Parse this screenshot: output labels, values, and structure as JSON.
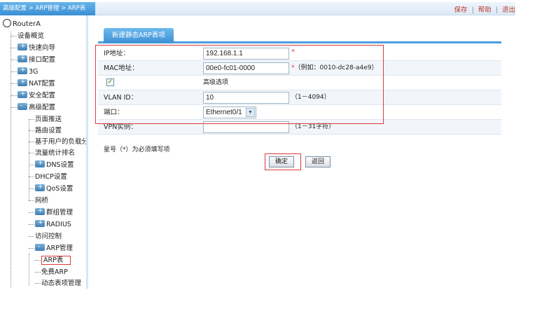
{
  "header": {
    "breadcrumb": "高级配置 > ARP管理 > ARP表",
    "save": "保存",
    "help": "帮助",
    "logout": "退出",
    "separator": "|"
  },
  "sidebar": {
    "root": "RouterA",
    "items": [
      {
        "label": "设备概览"
      },
      {
        "label": "快速向导"
      },
      {
        "label": "接口配置"
      },
      {
        "label": "3G"
      },
      {
        "label": "NAT配置"
      },
      {
        "label": "安全配置"
      },
      {
        "label": "高级配置"
      },
      {
        "label": "页面推送"
      },
      {
        "label": "路由设置"
      },
      {
        "label": "基于用户的负载分"
      },
      {
        "label": "流量统计排名"
      },
      {
        "label": "DNS设置"
      },
      {
        "label": "DHCP设置"
      },
      {
        "label": "QoS设置"
      },
      {
        "label": "网桥"
      },
      {
        "label": "群组管理"
      },
      {
        "label": "RADIUS"
      },
      {
        "label": "访问控制"
      },
      {
        "label": "ARP管理"
      },
      {
        "label": "ARP表"
      },
      {
        "label": "免费ARP"
      },
      {
        "label": "动态表项管理"
      }
    ]
  },
  "main": {
    "tab": "新建静态ARP表项",
    "form": {
      "ip_label": "IP地址：",
      "ip_value": "192.168.1.1",
      "mac_label": "MAC地址：",
      "mac_value": "00e0-fc01-0000",
      "mac_hint": "（例如：0010-dc28-a4e9）",
      "required_mark": "*",
      "checkbox_mark": "✓",
      "advanced_label": "高级选项",
      "vlan_label": "VLAN ID：",
      "vlan_value": "10",
      "vlan_hint": "（1－4094）",
      "port_label": "端口：",
      "port_value": "Ethernet0/1",
      "port_arrow": "▼",
      "vpn_label": "VPN实例：",
      "vpn_value": "",
      "vpn_hint": "（1－31字符）"
    },
    "note": "星号（*）为必须填写项",
    "ok_button": "确定",
    "back_button": "返回"
  },
  "colors": {
    "accent": "#3c90d4",
    "highlight": "#e03a3a",
    "link": "#c0392b"
  }
}
